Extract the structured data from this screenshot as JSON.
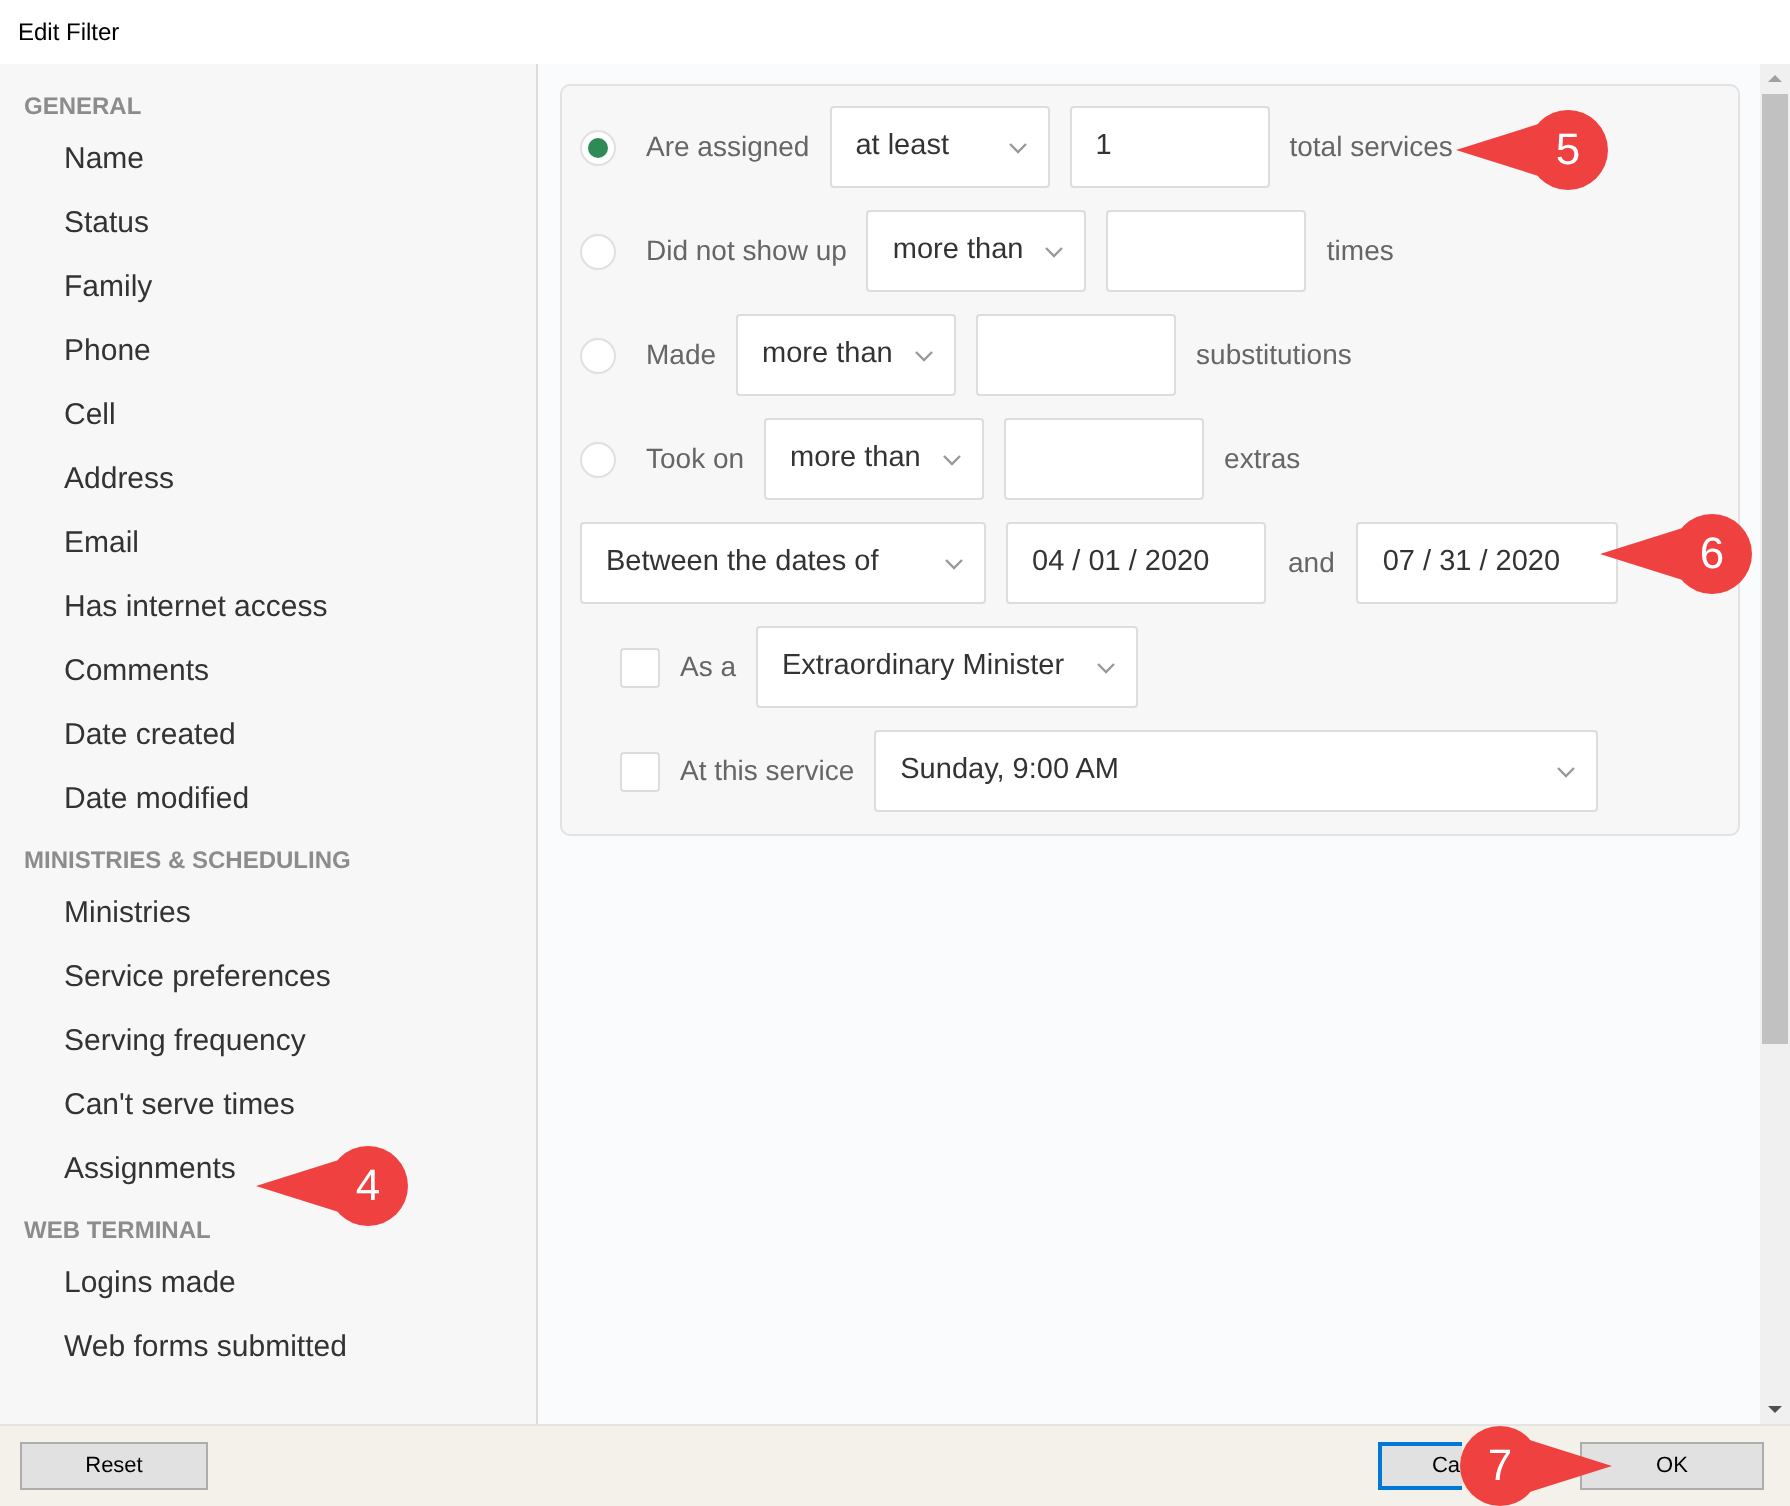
{
  "window": {
    "title": "Edit Filter"
  },
  "sidebar": {
    "sections": [
      {
        "heading": "GENERAL",
        "items": [
          "Name",
          "Status",
          "Family",
          "Phone",
          "Cell",
          "Address",
          "Email",
          "Has internet access",
          "Comments",
          "Date created",
          "Date modified"
        ]
      },
      {
        "heading": "MINISTRIES & SCHEDULING",
        "items": [
          "Ministries",
          "Service preferences",
          "Serving frequency",
          "Can't serve times",
          "Assignments"
        ]
      },
      {
        "heading": "WEB TERMINAL",
        "items": [
          "Logins made",
          "Web forms submitted"
        ]
      }
    ]
  },
  "criteria": [
    {
      "label": "Are assigned",
      "selected": true,
      "operator": "at least",
      "value": "1",
      "suffix": "total services"
    },
    {
      "label": "Did not show up",
      "selected": false,
      "operator": "more than",
      "suffix": "times"
    },
    {
      "label": "Made",
      "selected": false,
      "operator": "more than",
      "suffix": "substitutions"
    },
    {
      "label": "Took on",
      "selected": false,
      "operator": "more than",
      "suffix": "extras"
    }
  ],
  "date_range": {
    "mode": "Between the dates of",
    "start": "04 / 01 / 2020",
    "joiner": "and",
    "end": "07 / 31 / 2020"
  },
  "options": [
    {
      "label": "As a",
      "checked": false,
      "value": "Extraordinary Minister"
    },
    {
      "label": "At this service",
      "checked": false,
      "value": "Sunday, 9:00 AM"
    }
  ],
  "callouts": [
    {
      "number": "5"
    },
    {
      "number": "6"
    },
    {
      "number": "4"
    },
    {
      "number": "7"
    }
  ],
  "buttons": {
    "reset": "Reset",
    "cancel": "Ca",
    "ok": "OK"
  }
}
